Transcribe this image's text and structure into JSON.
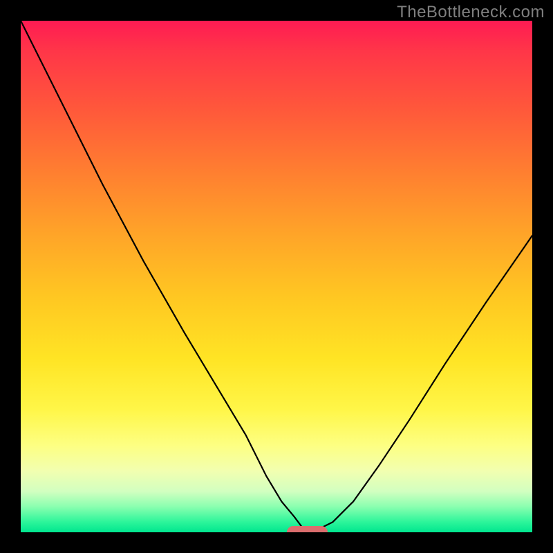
{
  "watermark": "TheBottleneck.com",
  "chart_data": {
    "type": "line",
    "title": "",
    "xlabel": "",
    "ylabel": "",
    "x_range_pct": [
      0,
      100
    ],
    "y_range_pct": [
      0,
      100
    ],
    "series": [
      {
        "name": "left-branch",
        "x_pct": [
          0,
          8,
          16,
          24,
          32,
          38,
          44,
          48,
          51,
          53.5,
          55,
          56
        ],
        "y_pct": [
          100,
          84,
          68,
          53,
          39,
          29,
          19,
          11,
          6,
          3,
          1,
          0
        ]
      },
      {
        "name": "right-branch",
        "x_pct": [
          56,
          58,
          61,
          65,
          70,
          76,
          83,
          91,
          100
        ],
        "y_pct": [
          0,
          0.5,
          2,
          6,
          13,
          22,
          33,
          45,
          58
        ]
      }
    ],
    "marker": {
      "name": "minimum-marker",
      "x_pct": 56,
      "y_pct": 0,
      "width_pct": 8,
      "height_pct": 2.4,
      "color": "#db6e6e"
    },
    "background_gradient": {
      "direction": "top-to-bottom",
      "stops": [
        {
          "pct": 0,
          "color": "#ff1b53"
        },
        {
          "pct": 18,
          "color": "#ff5a3a"
        },
        {
          "pct": 42,
          "color": "#ffa528"
        },
        {
          "pct": 66,
          "color": "#ffe424"
        },
        {
          "pct": 83,
          "color": "#fdff82"
        },
        {
          "pct": 95,
          "color": "#8affb0"
        },
        {
          "pct": 100,
          "color": "#00e68f"
        }
      ]
    }
  }
}
